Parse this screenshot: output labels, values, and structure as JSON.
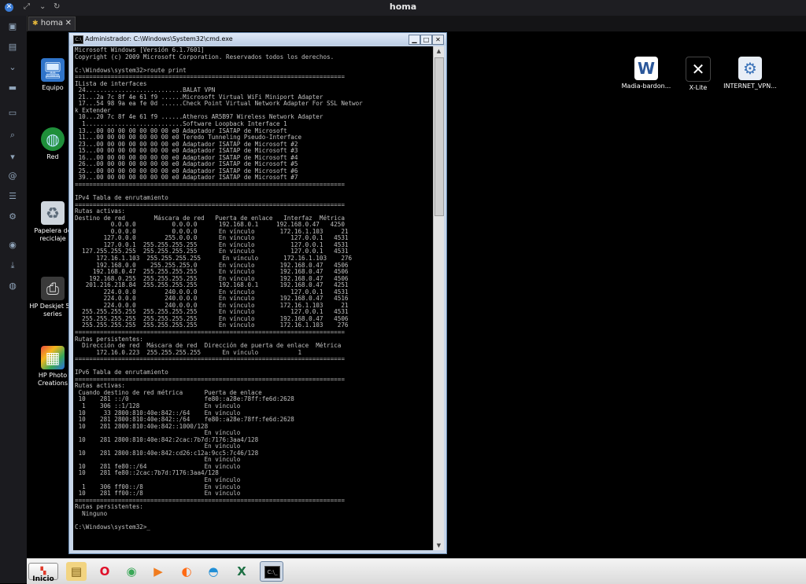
{
  "viewer": {
    "title": "homa",
    "tab_label": "homa",
    "tab_close": "✕"
  },
  "desktop_icons_left": [
    {
      "label": "Equipo",
      "icon": "computer-icon"
    },
    {
      "label": "Red",
      "icon": "network-globe-icon"
    },
    {
      "label": "Papelera de reciclaje",
      "icon": "recycle-bin-icon"
    },
    {
      "label": "HP Deskjet 5… series",
      "icon": "printer-icon"
    },
    {
      "label": "HP Photo Creations",
      "icon": "photo-app-icon"
    }
  ],
  "desktop_icons_right": [
    {
      "label": "Madia-bardon...",
      "icon": "word-document-icon"
    },
    {
      "label": "X-Lite",
      "icon": "softphone-icon"
    },
    {
      "label": "INTERNET_VPN...",
      "icon": "vpn-config-icon"
    }
  ],
  "cmd_window": {
    "title": "Administrador: C:\\Windows\\System32\\cmd.exe",
    "console_lines": [
      "Microsoft Windows [Versión 6.1.7601]",
      "Copyright (c) 2009 Microsoft Corporation. Reservados todos los derechos.",
      "",
      "C:\\Windows\\system32>route print",
      "===========================================================================",
      "ILista de interfaces",
      " 24...........................BALAT VPN",
      " 21...2a 7c 8f 4e 61 f9 ......Microsoft Virtual WiFi Miniport Adapter",
      " 17...54 98 9a ea fe 0d ......Check Point Virtual Network Adapter For SSL Networ",
      "k Extender",
      " 10...20 7c 8f 4e 61 f9 ......Atheros AR5B97 Wireless Network Adapter",
      "  1...........................Software Loopback Interface 1",
      " 13...00 00 00 00 00 00 00 e0 Adaptador ISATAP de Microsoft",
      " 11...00 00 00 00 00 00 00 e0 Teredo Tunneling Pseudo-Interface",
      " 23...00 00 00 00 00 00 00 e0 Adaptador ISATAP de Microsoft #2",
      " 15...00 00 00 00 00 00 00 e0 Adaptador ISATAP de Microsoft #3",
      " 16...00 00 00 00 00 00 00 e0 Adaptador ISATAP de Microsoft #4",
      " 26...00 00 00 00 00 00 00 e0 Adaptador ISATAP de Microsoft #5",
      " 25...00 00 00 00 00 00 00 e0 Adaptador ISATAP de Microsoft #6",
      " 39...00 00 00 00 00 00 00 e0 Adaptador ISATAP de Microsoft #7",
      "===========================================================================",
      "",
      "IPv4 Tabla de enrutamiento",
      "===========================================================================",
      "Rutas activas:",
      "Destino de red        Máscara de red   Puerta de enlace   Interfaz  Métrica",
      "          0.0.0.0          0.0.0.0      192.168.0.1     192.168.0.47   4250",
      "          0.0.0.0          0.0.0.0      En vínculo       172.16.1.103     21",
      "        127.0.0.0        255.0.0.0      En vínculo          127.0.0.1   4531",
      "        127.0.0.1  255.255.255.255      En vínculo          127.0.0.1   4531",
      "  127.255.255.255  255.255.255.255      En vínculo          127.0.0.1   4531",
      "      172.16.1.103  255.255.255.255      En vínculo       172.16.1.103    276",
      "      192.168.0.0    255.255.255.0      En vínculo       192.168.0.47   4506",
      "     192.168.0.47  255.255.255.255      En vínculo       192.168.0.47   4506",
      "    192.168.0.255  255.255.255.255      En vínculo       192.168.0.47   4506",
      "   201.216.218.84  255.255.255.255      192.168.0.1      192.168.0.47   4251",
      "        224.0.0.0        240.0.0.0      En vínculo          127.0.0.1   4531",
      "        224.0.0.0        240.0.0.0      En vínculo       192.168.0.47   4516",
      "        224.0.0.0        240.0.0.0      En vínculo       172.16.1.103     21",
      "  255.255.255.255  255.255.255.255      En vínculo          127.0.0.1   4531",
      "  255.255.255.255  255.255.255.255      En vínculo       192.168.0.47   4506",
      "  255.255.255.255  255.255.255.255      En vínculo       172.16.1.103    276",
      "===========================================================================",
      "Rutas persistentes:",
      "  Dirección de red  Máscara de red  Dirección de puerta de enlace  Métrica",
      "      172.16.0.223  255.255.255.255      En vínculo           1",
      "===========================================================================",
      "",
      "IPv6 Tabla de enrutamiento",
      "===========================================================================",
      "Rutas activas:",
      " Cuando destino de red métrica      Puerta de enlace",
      " 10    281 ::/0                     fe80::a28e:78ff:fe6d:2628",
      "  1    306 ::1/128                  En vínculo",
      " 10     33 2800:810:40e:842::/64    En vínculo",
      " 10    281 2800:810:40e:842::/64    fe80::a28e:78ff:fe6d:2628",
      " 10    281 2800:810:40e:842::1000/128",
      "                                    En vínculo",
      " 10    281 2800:810:40e:842:2cac:7b7d:7176:3aa4/128",
      "                                    En vínculo",
      " 10    281 2800:810:40e:842:cd26:c12a:9cc5:7c46/128",
      "                                    En vínculo",
      " 10    281 fe80::/64                En vínculo",
      " 10    281 fe80::2cac:7b7d:7176:3aa4/128",
      "                                    En vínculo",
      "  1    306 ff00::/8                 En vínculo",
      " 10    281 ff00::/8                 En vínculo",
      "===========================================================================",
      "Rutas persistentes:",
      "  Ninguno",
      "",
      "C:\\Windows\\system32>_"
    ]
  },
  "taskbar": {
    "start_label": "Inicio",
    "pinned": [
      "file-explorer-icon",
      "opera-icon",
      "chrome-icon",
      "media-player-icon",
      "firefox-icon",
      "edge-icon",
      "excel-icon"
    ],
    "active_task_glyph": "C:\\_"
  }
}
